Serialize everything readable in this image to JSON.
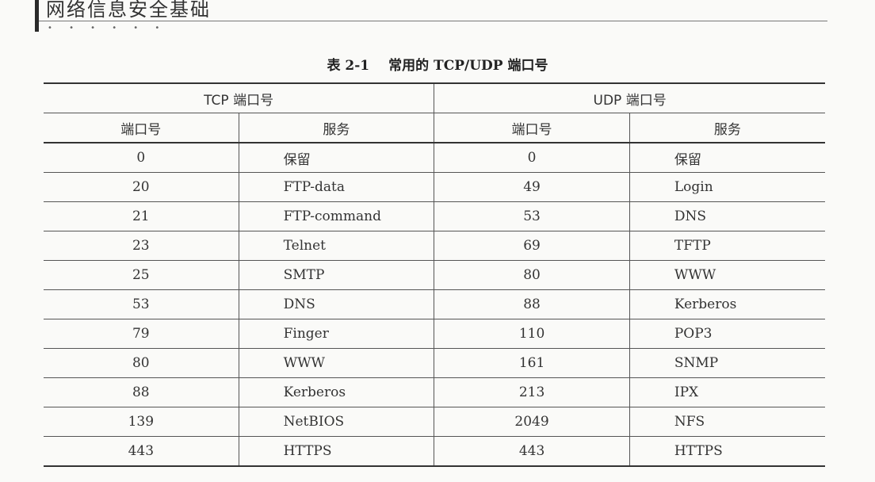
{
  "header": {
    "book_title": "网络信息安全基础",
    "dots": "• • • • • •"
  },
  "caption": {
    "number": "表 2-1",
    "title": "常用的 TCP/UDP 端口号"
  },
  "table": {
    "groups": {
      "tcp": "TCP 端口号",
      "udp": "UDP 端口号"
    },
    "columns": {
      "tcp_port": "端口号",
      "tcp_service": "服务",
      "udp_port": "端口号",
      "udp_service": "服务"
    },
    "rows": [
      {
        "tcp_port": "0",
        "tcp_service": "保留",
        "udp_port": "0",
        "udp_service": "保留"
      },
      {
        "tcp_port": "20",
        "tcp_service": "FTP-data",
        "udp_port": "49",
        "udp_service": "Login"
      },
      {
        "tcp_port": "21",
        "tcp_service": "FTP-command",
        "udp_port": "53",
        "udp_service": "DNS"
      },
      {
        "tcp_port": "23",
        "tcp_service": "Telnet",
        "udp_port": "69",
        "udp_service": "TFTP"
      },
      {
        "tcp_port": "25",
        "tcp_service": "SMTP",
        "udp_port": "80",
        "udp_service": "WWW"
      },
      {
        "tcp_port": "53",
        "tcp_service": "DNS",
        "udp_port": "88",
        "udp_service": "Kerberos"
      },
      {
        "tcp_port": "79",
        "tcp_service": "Finger",
        "udp_port": "110",
        "udp_service": "POP3"
      },
      {
        "tcp_port": "80",
        "tcp_service": "WWW",
        "udp_port": "161",
        "udp_service": "SNMP"
      },
      {
        "tcp_port": "88",
        "tcp_service": "Kerberos",
        "udp_port": "213",
        "udp_service": "IPX"
      },
      {
        "tcp_port": "139",
        "tcp_service": "NetBIOS",
        "udp_port": "2049",
        "udp_service": "NFS"
      },
      {
        "tcp_port": "443",
        "tcp_service": "HTTPS",
        "udp_port": "443",
        "udp_service": "HTTPS"
      }
    ]
  }
}
